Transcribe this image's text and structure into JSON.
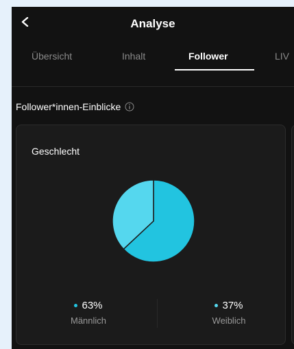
{
  "header": {
    "title": "Analyse"
  },
  "tabs": [
    {
      "label": "Übersicht",
      "active": false
    },
    {
      "label": "Inhalt",
      "active": false
    },
    {
      "label": "Follower",
      "active": true
    },
    {
      "label": "LIV",
      "active": false
    }
  ],
  "section": {
    "title": "Follower*innen-Einblicke"
  },
  "card": {
    "title": "Geschlecht",
    "legend": [
      {
        "value": "63%",
        "label": "Männlich",
        "color": "#22c4e0"
      },
      {
        "value": "37%",
        "label": "Weiblich",
        "color": "#55d7ee"
      }
    ]
  },
  "chart_data": {
    "type": "pie",
    "categories": [
      "Männlich",
      "Weiblich"
    ],
    "values": [
      63,
      37
    ],
    "colors": [
      "#22c4e0",
      "#55d7ee"
    ]
  },
  "colors": {
    "background": "#121212",
    "accent": "#22c4e0"
  }
}
